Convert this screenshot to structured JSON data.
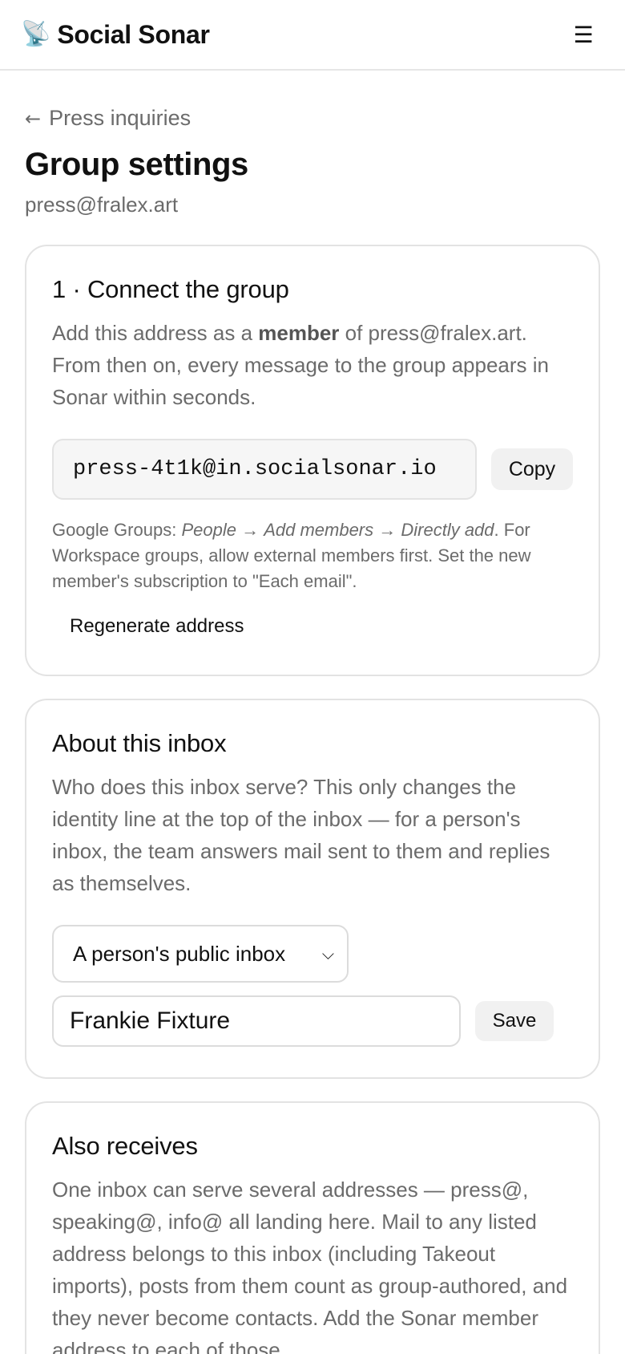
{
  "header": {
    "brand_icon": "satellite-antenna-icon",
    "brand_icon_glyph": "📡",
    "brand_name": "Social Sonar",
    "menu_glyph": "☰"
  },
  "page": {
    "back_arrow": "←",
    "back_label": "Press inquiries",
    "title": "Group settings",
    "subtitle": "press@fralex.art"
  },
  "connect": {
    "title": "1 · Connect the group",
    "text_prefix": "Add this address as a ",
    "text_strong": "member",
    "text_suffix": " of press@fralex.art. From then on, every message to the group appears in Sonar within seconds.",
    "address": "press-4t1k@in.socialsonar.io",
    "copy_label": "Copy",
    "hint_prefix": "Google Groups: ",
    "hint_people": "People",
    "hint_arrow": " → ",
    "hint_add_members": "Add members",
    "hint_directly_add": "Directly add",
    "hint_suffix": ". For Workspace groups, allow external members first. Set the new member's subscription to \"Each email\".",
    "regenerate_label": "Regenerate address"
  },
  "about": {
    "title": "About this inbox",
    "text": "Who does this inbox serve? This only changes the identity line at the top of the inbox — for a person's inbox, the team answers mail sent to them and replies as themselves.",
    "select_value": "A person's public inbox",
    "name_value": "Frankie Fixture",
    "save_label": "Save"
  },
  "also": {
    "title": "Also receives",
    "text": "One inbox can serve several addresses — press@, speaking@, info@ all landing here. Mail to any listed address belongs to this inbox (including Takeout imports), posts from them count as group-authored, and they never become contacts. Add the Sonar member address to each of those"
  },
  "colors": {
    "text_primary": "#111111",
    "text_muted": "#6b6b6b",
    "border": "#e3e3e3",
    "button_bg": "#f1f1f1"
  }
}
